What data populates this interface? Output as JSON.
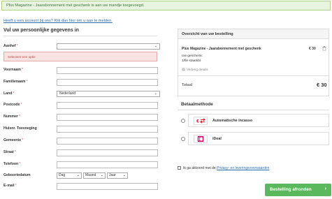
{
  "notice": "Plus Magazine - Jaarabonnement met geschenk is aan uw mandje toegevoegd.",
  "account_link": "Heeft u een account bij ons? Klik dan hier om u aan te melden.",
  "form": {
    "title": "Vul uw persoonlijke gegevens in",
    "aanhef_label": "Aanhef",
    "error": "Selecteer een optie",
    "voornaam_label": "Voornaam",
    "familienaam_label": "Familienaam",
    "land_label": "Land",
    "land_value": "Nederland",
    "postcode_label": "Postcode",
    "nummer_label": "Nummer",
    "huisnr_label": "Huisnr. Toevoeging",
    "gemeente_label": "Gemeente",
    "straat_label": "Straat",
    "telefoon_label": "Telefoon",
    "geboortedatum_label": "Geboortedatum",
    "dob_day": "Dag",
    "dob_month": "Maand",
    "dob_year": "Jaar",
    "email_label": "E-mail",
    "required_mark": "*"
  },
  "summary": {
    "title": "Overzicht van uw bestelling",
    "product": "Plus Magazine - Jaarabonnement met geschenk",
    "price": "€ 30",
    "gift_label": "Uw geschenk:",
    "gift_item": "1/fle staatsbl",
    "hide_details": "Verberg details",
    "total_label": "Totaal",
    "total_value": "€ 30"
  },
  "payment": {
    "title": "Betaalmethode",
    "options": [
      {
        "label": "Automatische incasso"
      },
      {
        "label": "iDeal"
      }
    ]
  },
  "terms": {
    "prefix": "Ik ga akkoord met de",
    "link": "Privacy- en leveringsvoorwaarden"
  },
  "submit_label": "Bestelling afronden",
  "colors": {
    "accent": "#5cb85c",
    "link": "#2a6fb5",
    "error": "#b94a48",
    "ideal": "#cc0066",
    "incasso": "#e2001a"
  }
}
